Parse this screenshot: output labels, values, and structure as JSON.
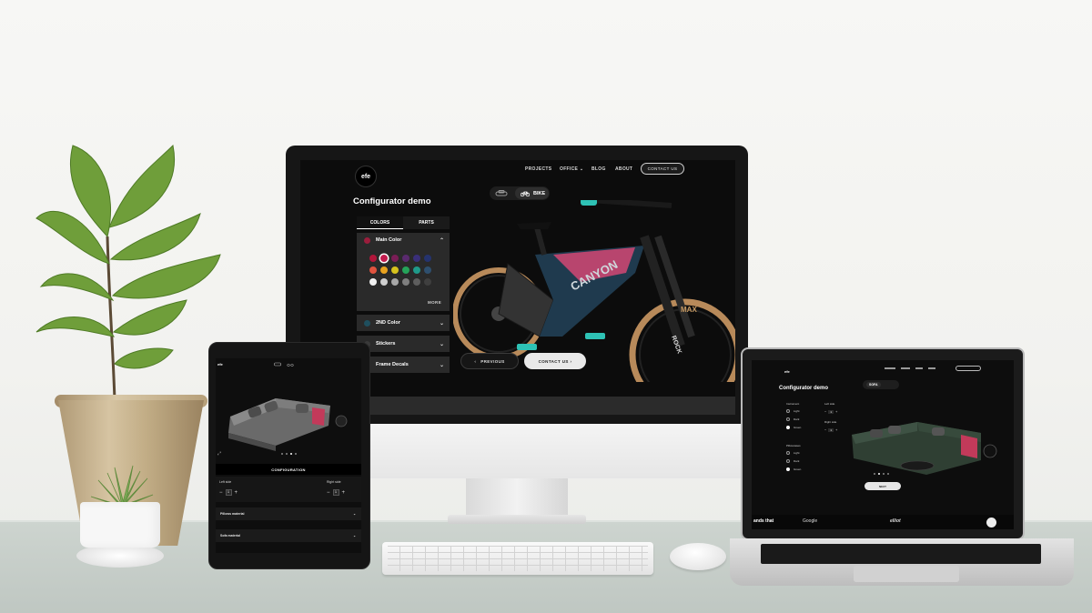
{
  "monitor": {
    "logo": "efe",
    "nav": {
      "projects": "PROJECTS",
      "office": "OFFICE",
      "blog": "BLOG",
      "about": "ABOUT",
      "contact": "CONTACT US"
    },
    "title": "Configurator demo",
    "toggle": {
      "active": "BIKE"
    },
    "tabs": {
      "colors": "COLORS",
      "parts": "PARTS"
    },
    "accordion": {
      "main_color": "Main Color",
      "second_color": "2ND Color",
      "stickers": "Stickers",
      "frame_decals": "Frame Decals"
    },
    "more_label": "MORE",
    "swatch_colors": [
      "#b0163a",
      "#c21b4e",
      "#7a1d56",
      "#5a2a6e",
      "#3a2f7a",
      "#25336e",
      "#e0533f",
      "#e8a21f",
      "#d6c21d",
      "#25a35a",
      "#1f9a8a",
      "#2e4f6e",
      "#f1f1f1",
      "#cfcfcf",
      "#a7a7a7",
      "#7f7f7f",
      "#5e5e5e",
      "#3f3f3f"
    ],
    "main_color_dot": "#9a1d3c",
    "second_color_dot": "#1f4f5e",
    "previous_label": "PREVIOUS",
    "contact_btn": "CONTACT US",
    "bike_brand": "CANYON",
    "tire_text": "MAX",
    "fork_text": "ROCK"
  },
  "tablet": {
    "logo": "efe",
    "section_title": "CONFIGURATION",
    "left_label": "Left side",
    "right_label": "Right side",
    "stepper_left": "1",
    "stepper_right": "1",
    "dropdown_1": "Pillows material",
    "dropdown_2": "Sofa material"
  },
  "laptop": {
    "logo": "efe",
    "title": "Configurator demo",
    "toggle_active": "SOFA",
    "group_1": "Instrument",
    "group_1_options": [
      "Light",
      "Dark",
      "Green"
    ],
    "side_label_1": "Left side",
    "side_label_2": "Right side",
    "stepper_1": "1",
    "stepper_2": "1",
    "group_2": "Pillowcases",
    "group_2_options": [
      "Light",
      "Dark",
      "Green"
    ],
    "bottom_btn": "NEXT",
    "footer_left": "ands that",
    "footer_brand": "Google",
    "footer_mid": "elliot"
  }
}
